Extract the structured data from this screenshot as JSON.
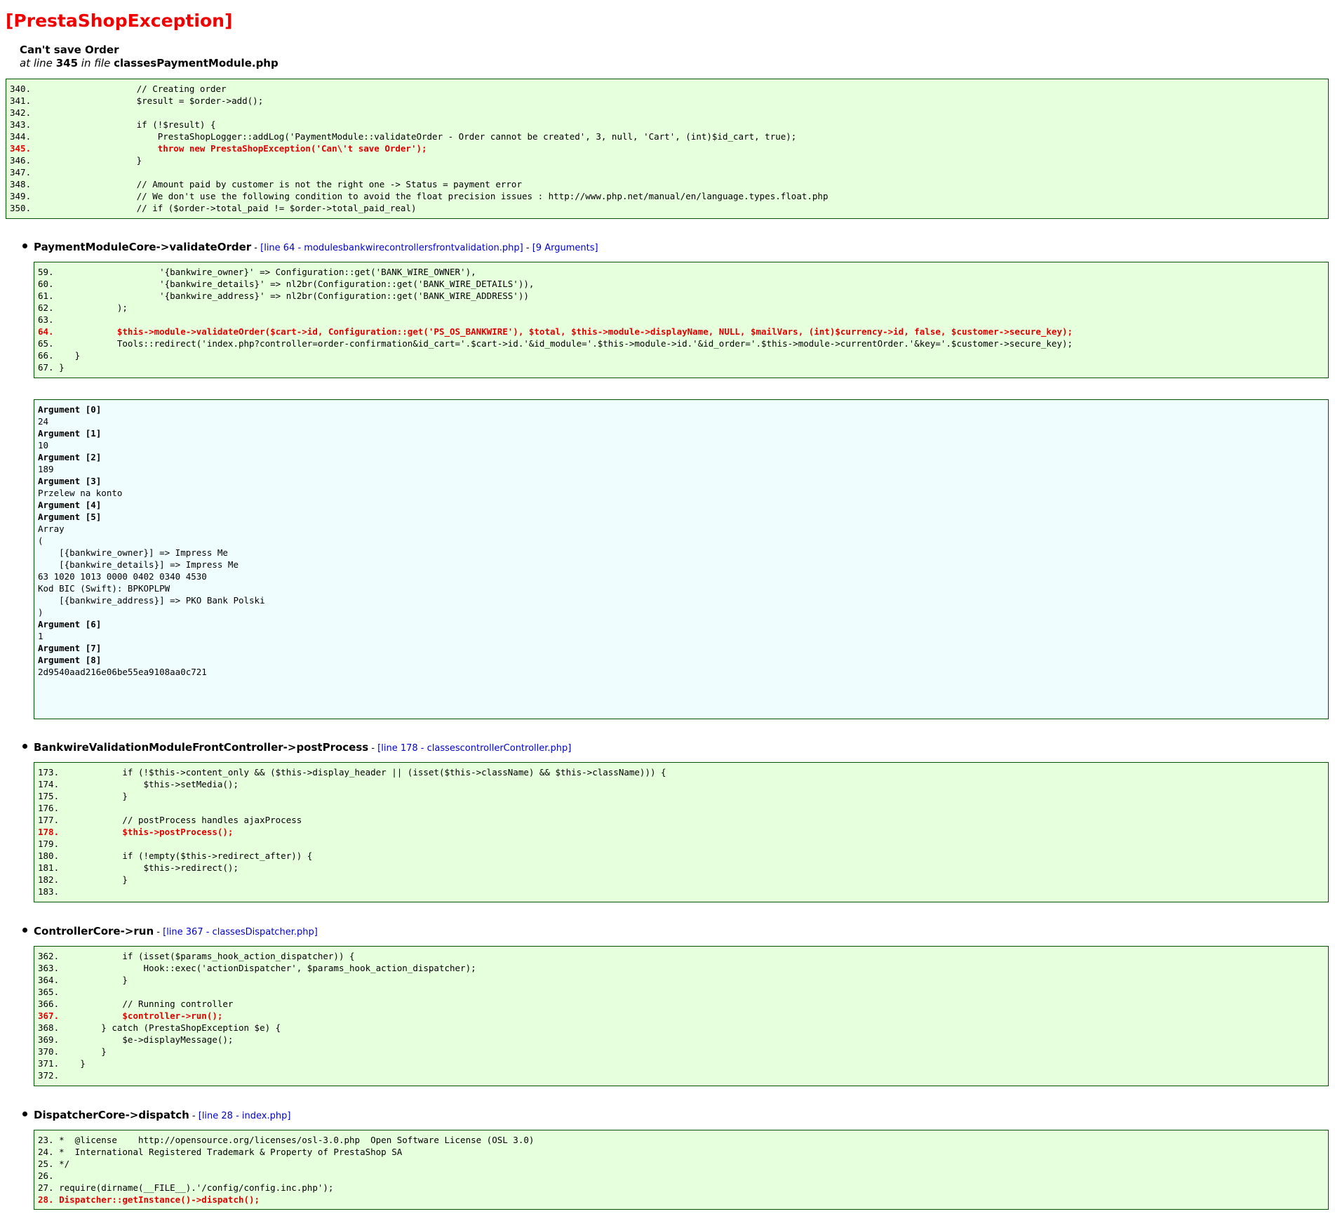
{
  "exception": {
    "title": "[PrestaShopException]",
    "message": "Can't save Order",
    "at_line_text": "at line",
    "line_number": "345",
    "in_file_text": "in file",
    "file": "classesPaymentModule.php"
  },
  "main_code": [
    {
      "text": "340.                    // Creating order",
      "error": false
    },
    {
      "text": "341.                    $result = $order->add();",
      "error": false
    },
    {
      "text": "342.",
      "error": false
    },
    {
      "text": "343.                    if (!$result) {",
      "error": false
    },
    {
      "text": "344.                        PrestaShopLogger::addLog('PaymentModule::validateOrder - Order cannot be created', 3, null, 'Cart', (int)$id_cart, true);",
      "error": false
    },
    {
      "text": "345.                        throw new PrestaShopException('Can\\'t save Order');",
      "error": true
    },
    {
      "text": "346.                    }",
      "error": false
    },
    {
      "text": "347.",
      "error": false
    },
    {
      "text": "348.                    // Amount paid by customer is not the right one -> Status = payment error",
      "error": false
    },
    {
      "text": "349.                    // We don't use the following condition to avoid the float precision issues : http://www.php.net/manual/en/language.types.float.php",
      "error": false
    },
    {
      "text": "350.                    // if ($order->total_paid != $order->total_paid_real)",
      "error": false
    }
  ],
  "trace": [
    {
      "function": "PaymentModuleCore->validateOrder",
      "separator": " - ",
      "location": "[line 64 - modulesbankwirecontrollersfrontvalidation.php]",
      "separator2": " - ",
      "args_link": "[9 Arguments]",
      "code": [
        {
          "text": "59.                    '{bankwire_owner}' => Configuration::get('BANK_WIRE_OWNER'),",
          "error": false
        },
        {
          "text": "60.                    '{bankwire_details}' => nl2br(Configuration::get('BANK_WIRE_DETAILS')),",
          "error": false
        },
        {
          "text": "61.                    '{bankwire_address}' => nl2br(Configuration::get('BANK_WIRE_ADDRESS'))",
          "error": false
        },
        {
          "text": "62.            );",
          "error": false
        },
        {
          "text": "63.",
          "error": false
        },
        {
          "text": "64.            $this->module->validateOrder($cart->id, Configuration::get('PS_OS_BANKWIRE'), $total, $this->module->displayName, NULL, $mailVars, (int)$currency->id, false, $customer->secure_key);",
          "error": true
        },
        {
          "text": "65.            Tools::redirect('index.php?controller=order-confirmation&id_cart='.$cart->id.'&id_module='.$this->module->id.'&id_order='.$this->module->currentOrder.'&key='.$customer->secure_key);",
          "error": false
        },
        {
          "text": "66.    }",
          "error": false
        },
        {
          "text": "67. }",
          "error": false
        }
      ],
      "arguments": [
        {
          "label": "Argument [0]",
          "value": "24"
        },
        {
          "label": "Argument [1]",
          "value": "10"
        },
        {
          "label": "Argument [2]",
          "value": "189"
        },
        {
          "label": "Argument [3]",
          "value": "Przelew na konto"
        },
        {
          "label": "Argument [4]",
          "value": ""
        },
        {
          "label": "Argument [5]",
          "value": "Array\n(\n    [{bankwire_owner}] => Impress Me\n    [{bankwire_details}] => Impress Me\n63 1020 1013 0000 0402 0340 4530\nKod BIC (Swift): BPKOPLPW\n    [{bankwire_address}] => PKO Bank Polski\n)\n"
        },
        {
          "label": "Argument [6]",
          "value": "1"
        },
        {
          "label": "Argument [7]",
          "value": ""
        },
        {
          "label": "Argument [8]",
          "value": "2d9540aad216e06be55ea9108aa0c721"
        }
      ]
    },
    {
      "function": "BankwireValidationModuleFrontController->postProcess",
      "separator": " - ",
      "location": "[line 178 - classescontrollerController.php]",
      "code": [
        {
          "text": "173.            if (!$this->content_only && ($this->display_header || (isset($this->className) && $this->className))) {",
          "error": false
        },
        {
          "text": "174.                $this->setMedia();",
          "error": false
        },
        {
          "text": "175.            }",
          "error": false
        },
        {
          "text": "176.",
          "error": false
        },
        {
          "text": "177.            // postProcess handles ajaxProcess",
          "error": false
        },
        {
          "text": "178.            $this->postProcess();",
          "error": true
        },
        {
          "text": "179.",
          "error": false
        },
        {
          "text": "180.            if (!empty($this->redirect_after)) {",
          "error": false
        },
        {
          "text": "181.                $this->redirect();",
          "error": false
        },
        {
          "text": "182.            }",
          "error": false
        },
        {
          "text": "183.",
          "error": false
        }
      ]
    },
    {
      "function": "ControllerCore->run",
      "separator": " - ",
      "location": "[line 367 - classesDispatcher.php]",
      "code": [
        {
          "text": "362.            if (isset($params_hook_action_dispatcher)) {",
          "error": false
        },
        {
          "text": "363.                Hook::exec('actionDispatcher', $params_hook_action_dispatcher);",
          "error": false
        },
        {
          "text": "364.            }",
          "error": false
        },
        {
          "text": "365.",
          "error": false
        },
        {
          "text": "366.            // Running controller",
          "error": false
        },
        {
          "text": "367.            $controller->run();",
          "error": true
        },
        {
          "text": "368.        } catch (PrestaShopException $e) {",
          "error": false
        },
        {
          "text": "369.            $e->displayMessage();",
          "error": false
        },
        {
          "text": "370.        }",
          "error": false
        },
        {
          "text": "371.    }",
          "error": false
        },
        {
          "text": "372.",
          "error": false
        }
      ]
    },
    {
      "function": "DispatcherCore->dispatch",
      "separator": " - ",
      "location": "[line 28 - index.php]",
      "code": [
        {
          "text": "23. *  @license    http://opensource.org/licenses/osl-3.0.php  Open Software License (OSL 3.0)",
          "error": false
        },
        {
          "text": "24. *  International Registered Trademark & Property of PrestaShop SA",
          "error": false
        },
        {
          "text": "25. */",
          "error": false
        },
        {
          "text": "26.",
          "error": false
        },
        {
          "text": "27. require(dirname(__FILE__).'/config/config.inc.php');",
          "error": false
        },
        {
          "text": "28. Dispatcher::getInstance()->dispatch();",
          "error": true
        }
      ]
    }
  ]
}
